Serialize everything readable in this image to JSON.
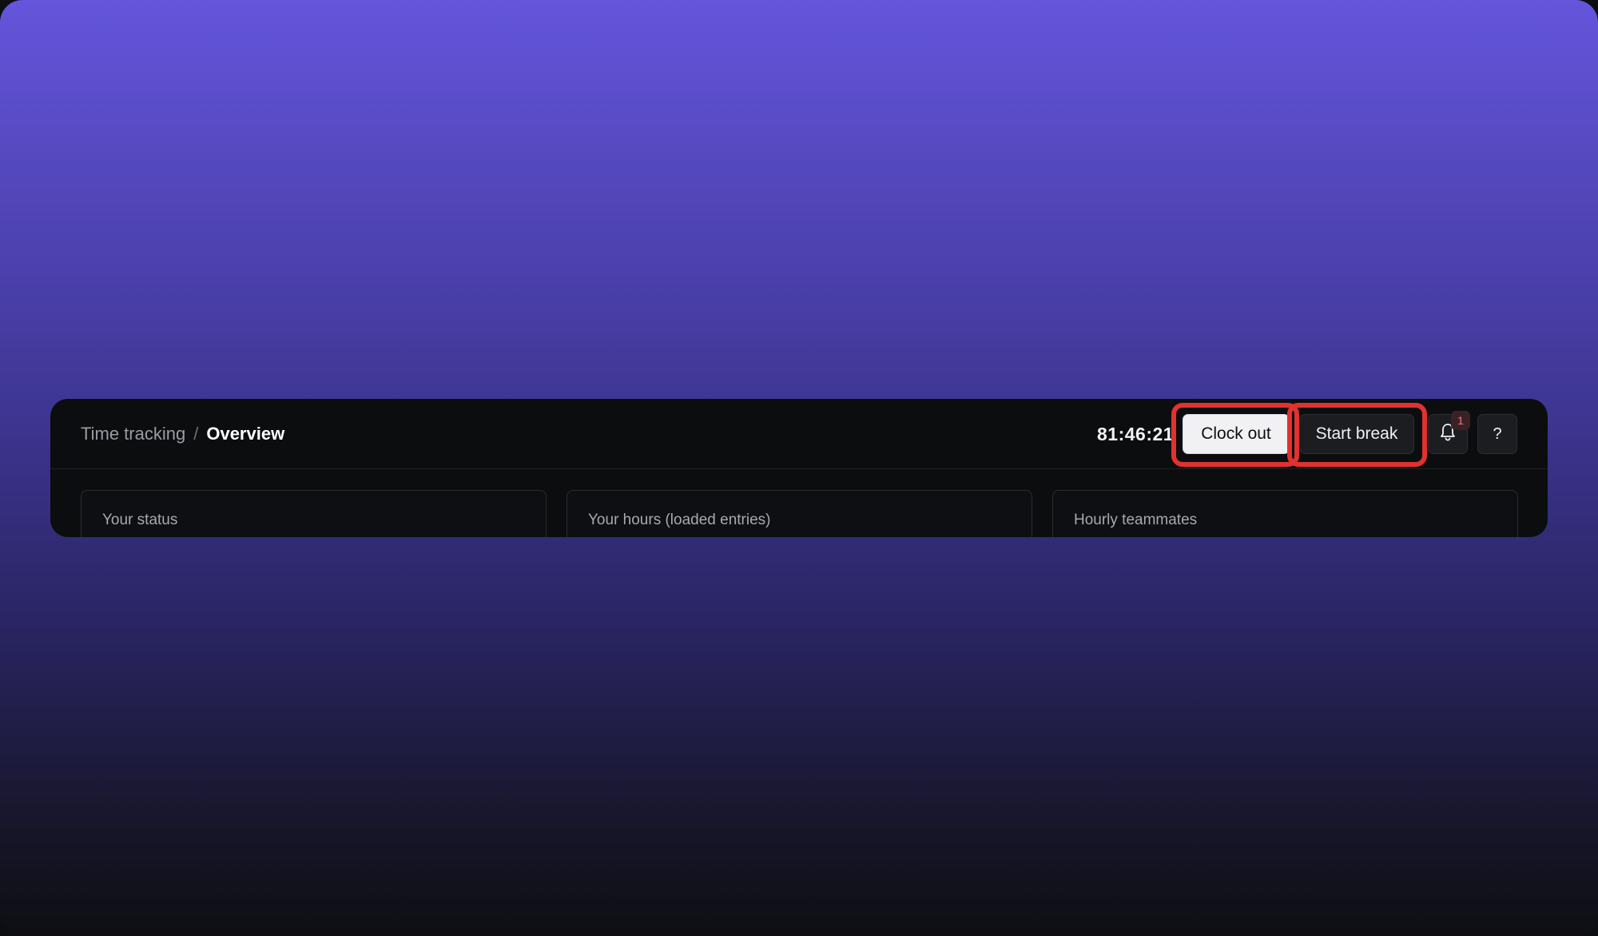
{
  "breadcrumb": {
    "parent": "Time tracking",
    "separator": "/",
    "current": "Overview"
  },
  "toolbar": {
    "timer": "81:46:21",
    "clock_out_label": "Clock out",
    "start_break_label": "Start break",
    "notification_count": "1",
    "help_label": "?",
    "bell_icon": "bell-icon"
  },
  "cards": [
    {
      "title": "Your status"
    },
    {
      "title": "Your hours (loaded entries)"
    },
    {
      "title": "Hourly teammates"
    }
  ],
  "colors": {
    "highlight": "#e0322e",
    "gradient_top": "#6455db",
    "gradient_bottom": "#0e0e13"
  }
}
